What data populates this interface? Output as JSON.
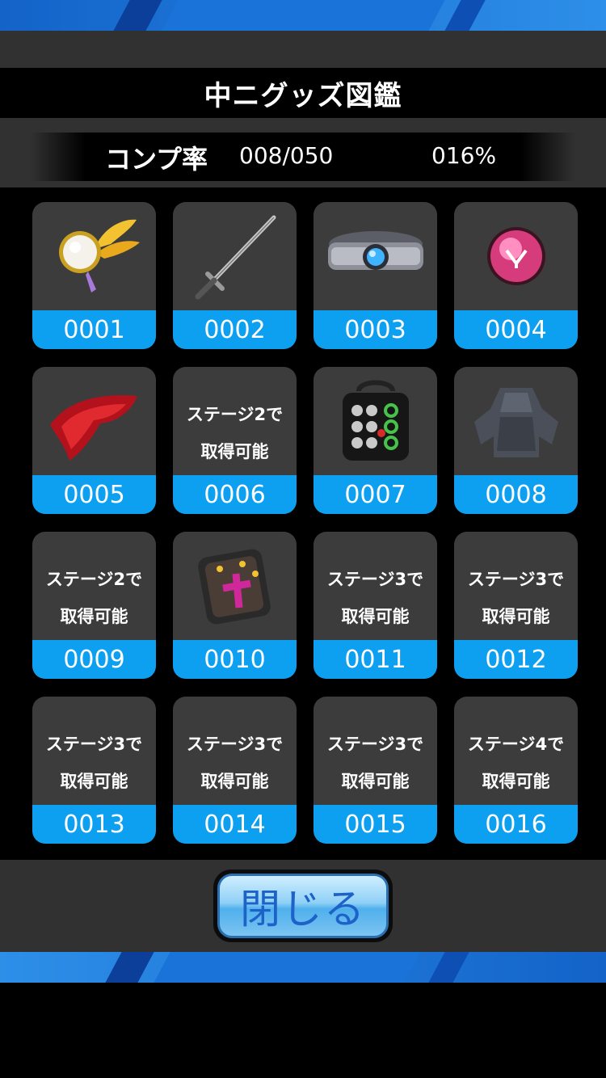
{
  "title": "中ニグッズ図鑑",
  "completion": {
    "label": "コンプ率",
    "count": "008/050",
    "percent": "016%"
  },
  "items": [
    {
      "number": "0001",
      "icon": "monocle-icon"
    },
    {
      "number": "0002",
      "icon": "sword-icon"
    },
    {
      "number": "0003",
      "icon": "belt-icon"
    },
    {
      "number": "0004",
      "icon": "pink-orb-icon"
    },
    {
      "number": "0005",
      "icon": "red-scarf-icon"
    },
    {
      "number": "0006",
      "lock_line1": "ステージ2で",
      "lock_line2": "取得可能"
    },
    {
      "number": "0007",
      "icon": "rings-case-icon"
    },
    {
      "number": "0008",
      "icon": "armor-vest-icon"
    },
    {
      "number": "0009",
      "lock_line1": "ステージ2で",
      "lock_line2": "取得可能"
    },
    {
      "number": "0010",
      "icon": "pouch-icon"
    },
    {
      "number": "0011",
      "lock_line1": "ステージ3で",
      "lock_line2": "取得可能"
    },
    {
      "number": "0012",
      "lock_line1": "ステージ3で",
      "lock_line2": "取得可能"
    },
    {
      "number": "0013",
      "lock_line1": "ステージ3で",
      "lock_line2": "取得可能"
    },
    {
      "number": "0014",
      "lock_line1": "ステージ3で",
      "lock_line2": "取得可能"
    },
    {
      "number": "0015",
      "lock_line1": "ステージ3で",
      "lock_line2": "取得可能"
    },
    {
      "number": "0016",
      "lock_line1": "ステージ4で",
      "lock_line2": "取得可能"
    }
  ],
  "close_button": "閉じる",
  "colors": {
    "accent_blue": "#0d9ff0",
    "card_bg": "#3c3c3c",
    "panel_bg": "#313131"
  }
}
